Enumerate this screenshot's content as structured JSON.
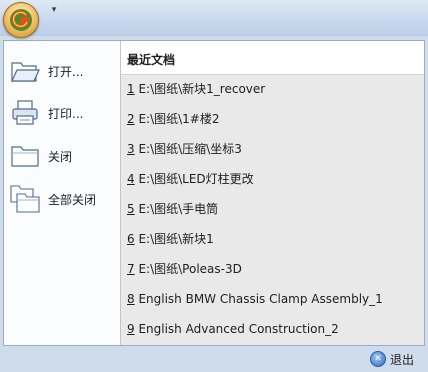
{
  "menu": {
    "commands": [
      {
        "label": "打开...",
        "icon": "open-folder-icon"
      },
      {
        "label": "打印...",
        "icon": "printer-icon"
      },
      {
        "label": "关闭",
        "icon": "folder-icon"
      },
      {
        "label": "全部关闭",
        "icon": "folders-icon"
      }
    ]
  },
  "recent": {
    "title": "最近文档",
    "items": [
      {
        "num": "1",
        "path": " E:\\图纸\\新块1_recover"
      },
      {
        "num": "2",
        "path": " E:\\图纸\\1#楼2"
      },
      {
        "num": "3",
        "path": " E:\\图纸\\压缩\\坐标3"
      },
      {
        "num": "4",
        "path": " E:\\图纸\\LED灯柱更改"
      },
      {
        "num": "5",
        "path": " E:\\图纸\\手电筒"
      },
      {
        "num": "6",
        "path": " E:\\图纸\\新块1"
      },
      {
        "num": "7",
        "path": " E:\\图纸\\Poleas-3D"
      },
      {
        "num": "8",
        "path": " English BMW Chassis Clamp Assembly_1"
      },
      {
        "num": "9",
        "path": " English Advanced Construction_2"
      }
    ]
  },
  "footer": {
    "exit_label": "退出"
  },
  "colors": {
    "accent": "#2f6fc4",
    "pane_bg": "#e9e9e9",
    "frame": "#9aabc3"
  }
}
